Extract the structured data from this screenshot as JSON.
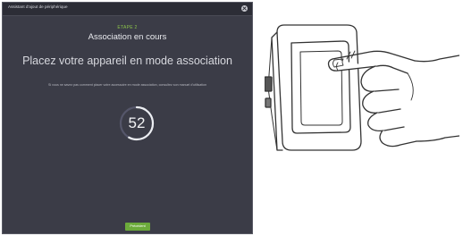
{
  "dialog": {
    "title": "Assistant d'ajout de périphérique",
    "step": "ETAPE 2",
    "heading": "Association en cours",
    "main_message": "Placez votre appareil en mode association",
    "hint": "Si vous ne savez pas comment placer votre accessoire en mode association, consultez son manuel d'utilisation",
    "countdown": "52",
    "countdown_progress": 0.58,
    "next_label": "Précédent"
  },
  "colors": {
    "dialog_bg": "#3b3c47",
    "accent_green": "#6cab3b",
    "step_green": "#8bc34a"
  },
  "icons": {
    "close": "close-icon",
    "illustration": "hand-pressing-wall-switch"
  }
}
